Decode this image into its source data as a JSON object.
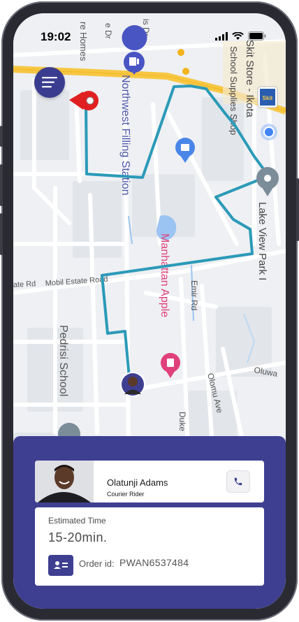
{
  "status_bar": {
    "time": "19:02"
  },
  "map": {
    "labels": {
      "homes": "re Homes",
      "dr": "e Dr",
      "is_dr": "is Dr",
      "filling_station": "Northwest Filling Station",
      "skit_store": "Skit Store - Ikota",
      "school_supplies": "School Supplies Shop",
      "lake_view": "Lake View Park I",
      "manhattan": "Manhattan Apple",
      "emir": "Emir Rd",
      "estate": "ate Rd",
      "mobil": "Mobil Estate Road",
      "pedrisi": "Pedrisi School",
      "olomu": "Olomu Ave",
      "oluwa": "Oluwa",
      "duke": "Duke",
      "shop_badge": "Skit"
    }
  },
  "route_color": "#2b9ab8",
  "accent_color": "#3e3f91",
  "rider": {
    "name": "Olatunji Adams",
    "role": "Courier Rider"
  },
  "delivery": {
    "estimated_label": "Estimated Time",
    "estimated_value": "15-20min.",
    "order_label": "Order id:",
    "order_id": "PWAN6537484"
  }
}
